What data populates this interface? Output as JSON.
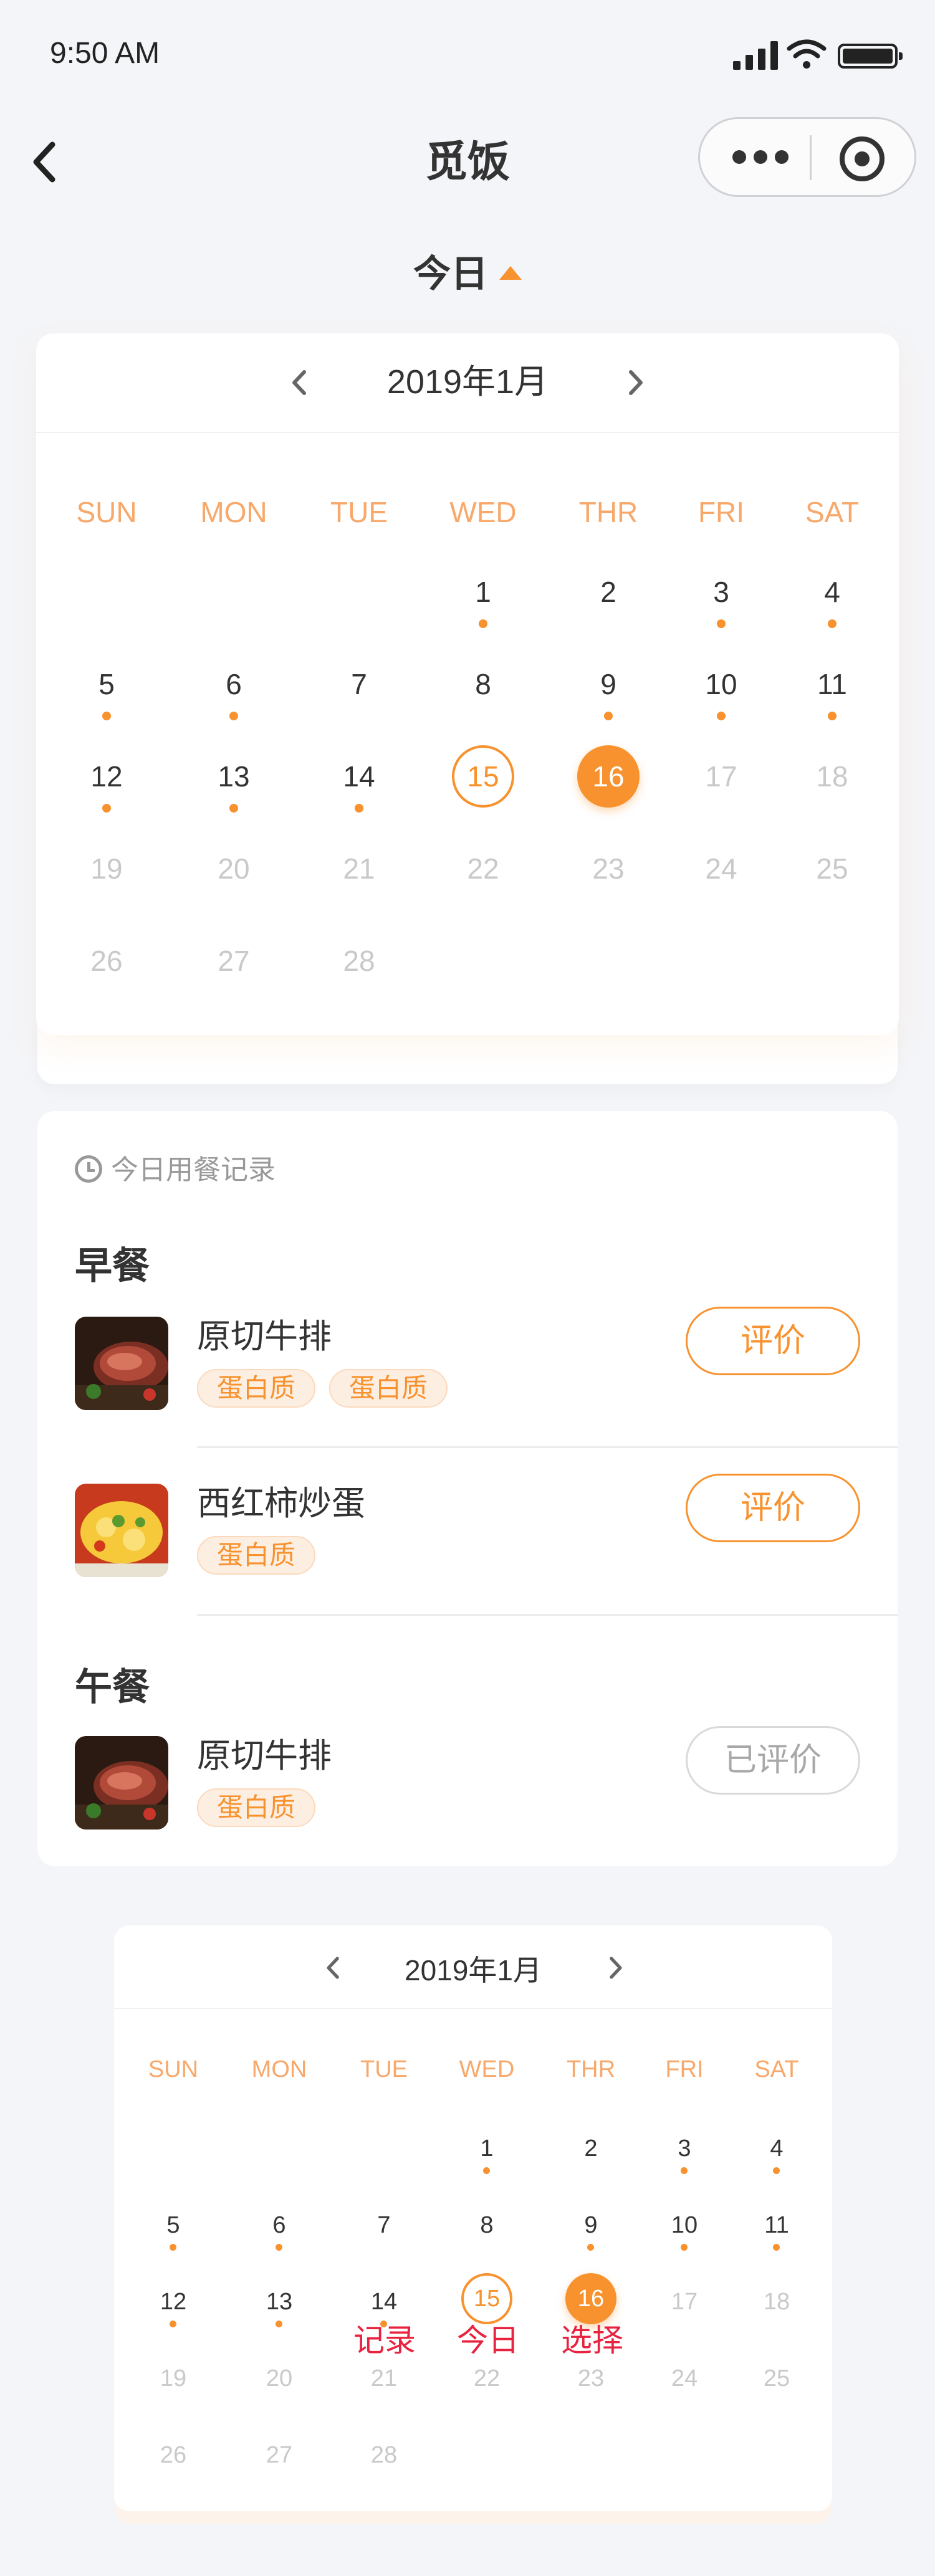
{
  "status_bar": {
    "time": "9:50 AM"
  },
  "nav": {
    "title": "觅饭"
  },
  "today_toggle": {
    "label": "今日"
  },
  "colors": {
    "accent": "#f7922e",
    "annotation": "#e8233f",
    "background": "#f4f5f8"
  },
  "calendar": {
    "month_label": "2019年1月",
    "weekdays": [
      "SUN",
      "MON",
      "TUE",
      "WED",
      "THR",
      "FRI",
      "SAT"
    ],
    "today": 15,
    "selected": 16,
    "days_with_records": [
      1,
      3,
      4,
      5,
      6,
      9,
      10,
      11,
      12,
      13,
      14
    ],
    "first_weekday_index": 3,
    "days_in_month": 28
  },
  "meal_records": {
    "heading": "今日用餐记录",
    "sections": [
      {
        "title": "早餐",
        "dishes": [
          {
            "name": "原切牛排",
            "tags": [
              "蛋白质",
              "蛋白质"
            ],
            "action": "评价",
            "rated": false,
            "image": "steak"
          },
          {
            "name": "西红柿炒蛋",
            "tags": [
              "蛋白质"
            ],
            "action": "评价",
            "rated": false,
            "image": "eggs"
          }
        ]
      },
      {
        "title": "午餐",
        "dishes": [
          {
            "name": "原切牛排",
            "tags": [
              "蛋白质"
            ],
            "action": "已评价",
            "rated": true,
            "image": "steak"
          }
        ]
      }
    ]
  },
  "calendar_legend": {
    "month_label": "2019年1月",
    "annotations": {
      "record": "记录",
      "today": "今日",
      "select": "选择"
    }
  }
}
